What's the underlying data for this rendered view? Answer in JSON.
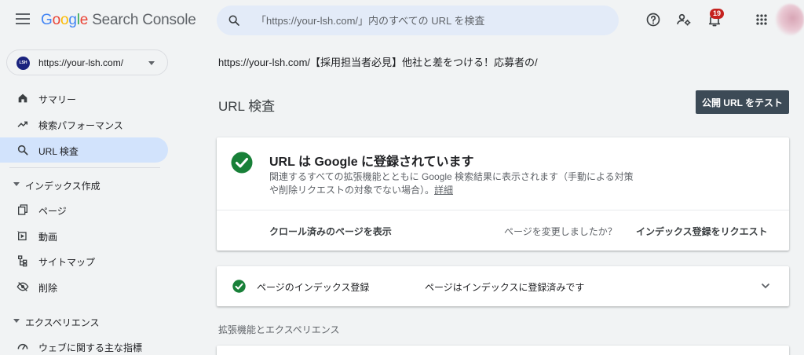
{
  "header": {
    "logo_parts": [
      "G",
      "o",
      "o",
      "g",
      "l",
      "e"
    ],
    "logo_rest": " Search Console",
    "search_placeholder": "「https://your-lsh.com/」内のすべての URL を検査",
    "notification_count": "19"
  },
  "property": {
    "logo_text": "LSH",
    "url": "https://your-lsh.com/"
  },
  "sidebar": {
    "items": [
      {
        "label": "サマリー",
        "icon": "home-icon"
      },
      {
        "label": "検索パフォーマンス",
        "icon": "trending-up-icon"
      },
      {
        "label": "URL 検査",
        "icon": "search-icon"
      }
    ],
    "section_index": "インデックス作成",
    "index_items": [
      {
        "label": "ページ",
        "icon": "pages-icon"
      },
      {
        "label": "動画",
        "icon": "video-icon"
      },
      {
        "label": "サイトマップ",
        "icon": "sitemap-icon"
      },
      {
        "label": "削除",
        "icon": "removals-icon"
      }
    ],
    "section_experience": "エクスペリエンス",
    "experience_items": [
      {
        "label": "ウェブに関する主な指標",
        "icon": "speed-icon"
      }
    ]
  },
  "main": {
    "breadcrumb": "https://your-lsh.com/【採用担当者必見】他社と差をつける！応募者の/",
    "title": "URL 検査",
    "test_button": "公開 URL をテスト",
    "status_title": "URL は Google に登録されています",
    "status_desc": "関連するすべての拡張機能とともに Google 検索結果に表示されます（手動による対策や削除リクエストの対象でない場合）。",
    "details_link": "詳細",
    "crawled_link": "クロール済みのページを表示",
    "changed_question": "ページを変更しましたか？",
    "request_link": "インデックス登録をリクエスト",
    "indexing_label": "ページのインデックス登録",
    "indexing_status": "ページはインデックスに登録済みです",
    "enhancements_heading": "拡張機能とエクスペリエンス"
  },
  "colors": {
    "success_green": "#188038",
    "active_nav": "#d2e3fc",
    "button_dark": "#3c4a56"
  }
}
